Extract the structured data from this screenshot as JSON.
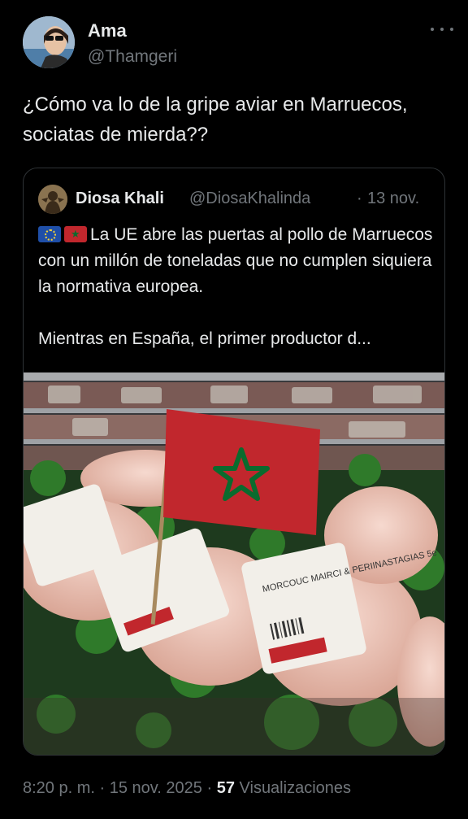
{
  "author": {
    "display_name": "Ama",
    "handle": "@Thamgeri"
  },
  "tweet": {
    "text": "¿Cómo va lo de la gripe aviar en Marruecos, sociatas de mierda??",
    "time": "8:20 p. m.",
    "separator": "·",
    "date": "15 nov. 2025",
    "views_count": "57",
    "views_label": "Visualizaciones"
  },
  "quoted": {
    "display_name": "Diosa Khali",
    "handle": "@DiosaKhalinda",
    "separator": "·",
    "date": "13 nov.",
    "flags": [
      "eu-flag-icon",
      "morocco-flag-icon"
    ],
    "text_line1": "La UE abre las puertas al pollo de Marruecos con un millón de toneladas que no cumplen siquiera la normativa europea.",
    "text_line2": "Mientras en España, el primer productor d...",
    "image_label_text": "MORCOUC MAIRCI & PERIINASTAGIAS 5e"
  },
  "colors": {
    "background": "#000000",
    "text_primary": "#e7e9ea",
    "text_secondary": "#71767b",
    "border": "#2f3336",
    "morocco_red": "#c1272d",
    "morocco_green": "#0a6b2e"
  }
}
